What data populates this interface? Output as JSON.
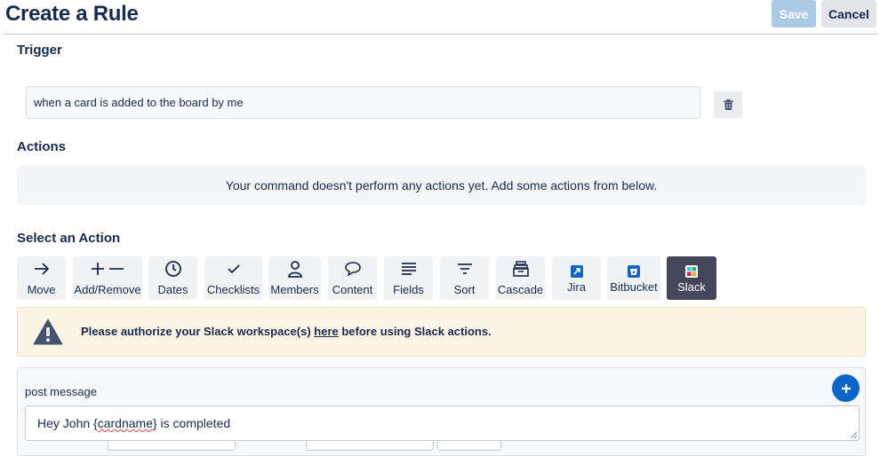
{
  "header": {
    "title": "Create a Rule",
    "save_label": "Save",
    "cancel_label": "Cancel"
  },
  "trigger": {
    "heading": "Trigger",
    "value": "when a card is added to the board by me",
    "delete_icon": "trash-icon"
  },
  "actions": {
    "heading": "Actions",
    "empty_message": "Your command doesn't perform any actions yet. Add some actions from below."
  },
  "select_action": {
    "heading": "Select an Action",
    "items": [
      {
        "label": "Move",
        "icon": "arrow-right-icon"
      },
      {
        "label": "Add/Remove",
        "icon": "plus-minus-icon"
      },
      {
        "label": "Dates",
        "icon": "clock-icon"
      },
      {
        "label": "Checklists",
        "icon": "check-icon"
      },
      {
        "label": "Members",
        "icon": "person-icon"
      },
      {
        "label": "Content",
        "icon": "speech-bubble-icon"
      },
      {
        "label": "Fields",
        "icon": "lines-icon"
      },
      {
        "label": "Sort",
        "icon": "sort-icon"
      },
      {
        "label": "Cascade",
        "icon": "archive-box-icon"
      },
      {
        "label": "Jira",
        "icon": "jira-icon"
      },
      {
        "label": "Bitbucket",
        "icon": "bitbucket-icon"
      },
      {
        "label": "Slack",
        "icon": "slack-icon",
        "selected": true
      }
    ]
  },
  "warning": {
    "text_before": "Please authorize your Slack workspace(s) ",
    "link_text": "here",
    "text_after": " before using Slack actions.",
    "icon": "warning-triangle-icon"
  },
  "post_message": {
    "label": "post message",
    "value_before": "Hey John {",
    "value_misspelled": "cardname",
    "value_after": "} is completed",
    "add_icon": "plus-icon"
  },
  "colors": {
    "primary": "#0c66c9",
    "save_disabled": "#a9c9e5",
    "selected_action": "#44475a",
    "warning_bg": "#fdf4e6",
    "text": "#172b4d"
  }
}
